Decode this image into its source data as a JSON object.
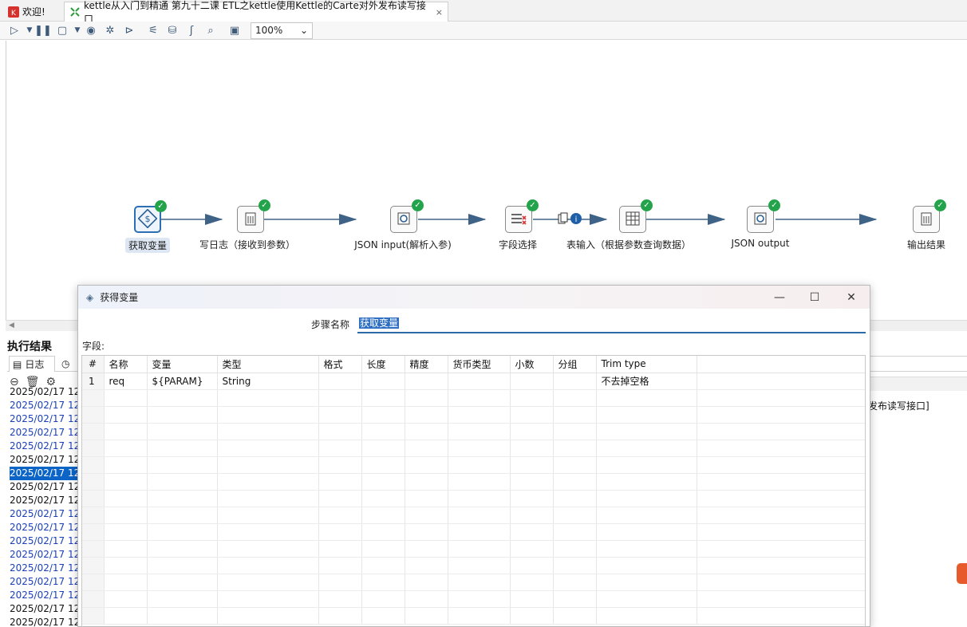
{
  "tabs": [
    {
      "label": "欢迎!",
      "icon": "kettle-welcome-icon"
    },
    {
      "label": "kettle从入门到精通 第九十二课 ETL之kettle使用Kettle的Carte对外发布读写接口",
      "icon": "transformation-icon",
      "close": "⨯"
    }
  ],
  "toolbar": {
    "zoom": "100%"
  },
  "canvas": {
    "steps": [
      {
        "label": "获取变量",
        "icon": "get-variables-icon",
        "selected": true
      },
      {
        "label": "写日志（接收到参数）",
        "icon": "write-log-icon"
      },
      {
        "label": "JSON input(解析入参)",
        "icon": "json-input-icon"
      },
      {
        "label": "字段选择",
        "icon": "select-fields-icon"
      },
      {
        "label": "表输入（根据参数查询数据）",
        "icon": "table-input-icon"
      },
      {
        "label": "JSON output",
        "icon": "json-output-icon"
      },
      {
        "label": "输出结果",
        "icon": "output-result-icon"
      }
    ]
  },
  "results": {
    "title": "执行结果",
    "log_tab": "日志",
    "log_lines": [
      {
        "text": "2025/02/17 12",
        "color": "black"
      },
      {
        "text": "2025/02/17 12",
        "color": "blue"
      },
      {
        "text": "2025/02/17 12",
        "color": "blue"
      },
      {
        "text": "2025/02/17 12",
        "color": "blue"
      },
      {
        "text": "2025/02/17 12",
        "color": "blue"
      },
      {
        "text": "2025/02/17 12",
        "color": "black"
      },
      {
        "text": "2025/02/17 12",
        "color": "selected"
      },
      {
        "text": "2025/02/17 12",
        "color": "black"
      },
      {
        "text": "2025/02/17 12",
        "color": "black"
      },
      {
        "text": "2025/02/17 12",
        "color": "blue"
      },
      {
        "text": "2025/02/17 12",
        "color": "blue"
      },
      {
        "text": "2025/02/17 12",
        "color": "blue"
      },
      {
        "text": "2025/02/17 12",
        "color": "blue"
      },
      {
        "text": "2025/02/17 12",
        "color": "blue"
      },
      {
        "text": "2025/02/17 12",
        "color": "blue"
      },
      {
        "text": "2025/02/17 12",
        "color": "blue"
      },
      {
        "text": "2025/02/17 12",
        "color": "black"
      },
      {
        "text": "2025/02/17 12",
        "color": "black"
      },
      {
        "text": "2025/02/17 12",
        "color": "black"
      }
    ],
    "right_text": "发布读写接口]"
  },
  "dialog": {
    "title": "获得变量",
    "step_name_label": "步骤名称",
    "step_name_value": "获取变量",
    "fields_label": "字段:",
    "columns": [
      "#",
      "名称",
      "变量",
      "类型",
      "格式",
      "长度",
      "精度",
      "货币类型",
      "小数",
      "分组",
      "Trim type",
      ""
    ],
    "rows": [
      [
        "1",
        "req",
        "${PARAM}",
        "String",
        "",
        "",
        "",
        "",
        "",
        "",
        "不去掉空格",
        ""
      ]
    ],
    "empty_rows": 14
  }
}
